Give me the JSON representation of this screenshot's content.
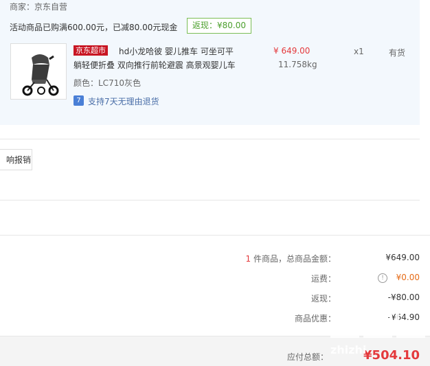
{
  "shop": {
    "merchant": "商家：京东自营",
    "promo": "活动商品已购满600.00元，已减80.00元现金",
    "rebate_tag": "返现：¥80.00"
  },
  "item": {
    "tag": "京东超市",
    "title_line1": "hd小龙哈彼 婴儿推车 可坐可平",
    "title_line2": "躺轻便折叠 双向推行前轮避震 高景观婴儿车",
    "color": "颜色：LC710灰色",
    "return_policy": "支持7天无理由退货",
    "price": "¥ 649.00",
    "weight": "11.758kg",
    "qty": "x1",
    "stock": "有货"
  },
  "invoice": {
    "label": "响报销"
  },
  "summary": {
    "count": "1",
    "items_label": " 件商品，总商品金额：",
    "items_value": "¥649.00",
    "shipping_label": "运费：",
    "shipping_value": "¥0.00",
    "rebate_label": "返现：",
    "rebate_value": "-¥80.00",
    "discount_label": "商品优惠：",
    "discount_value": "-¥64.90",
    "total_label": "应付总额：",
    "total_value": "¥504.10"
  },
  "watermark": {
    "text": "zhizhi"
  },
  "colors": {
    "accent_red": "#e4393c",
    "rebate_green": "#4b9f2c",
    "panel_bg": "#f3f8fd"
  }
}
